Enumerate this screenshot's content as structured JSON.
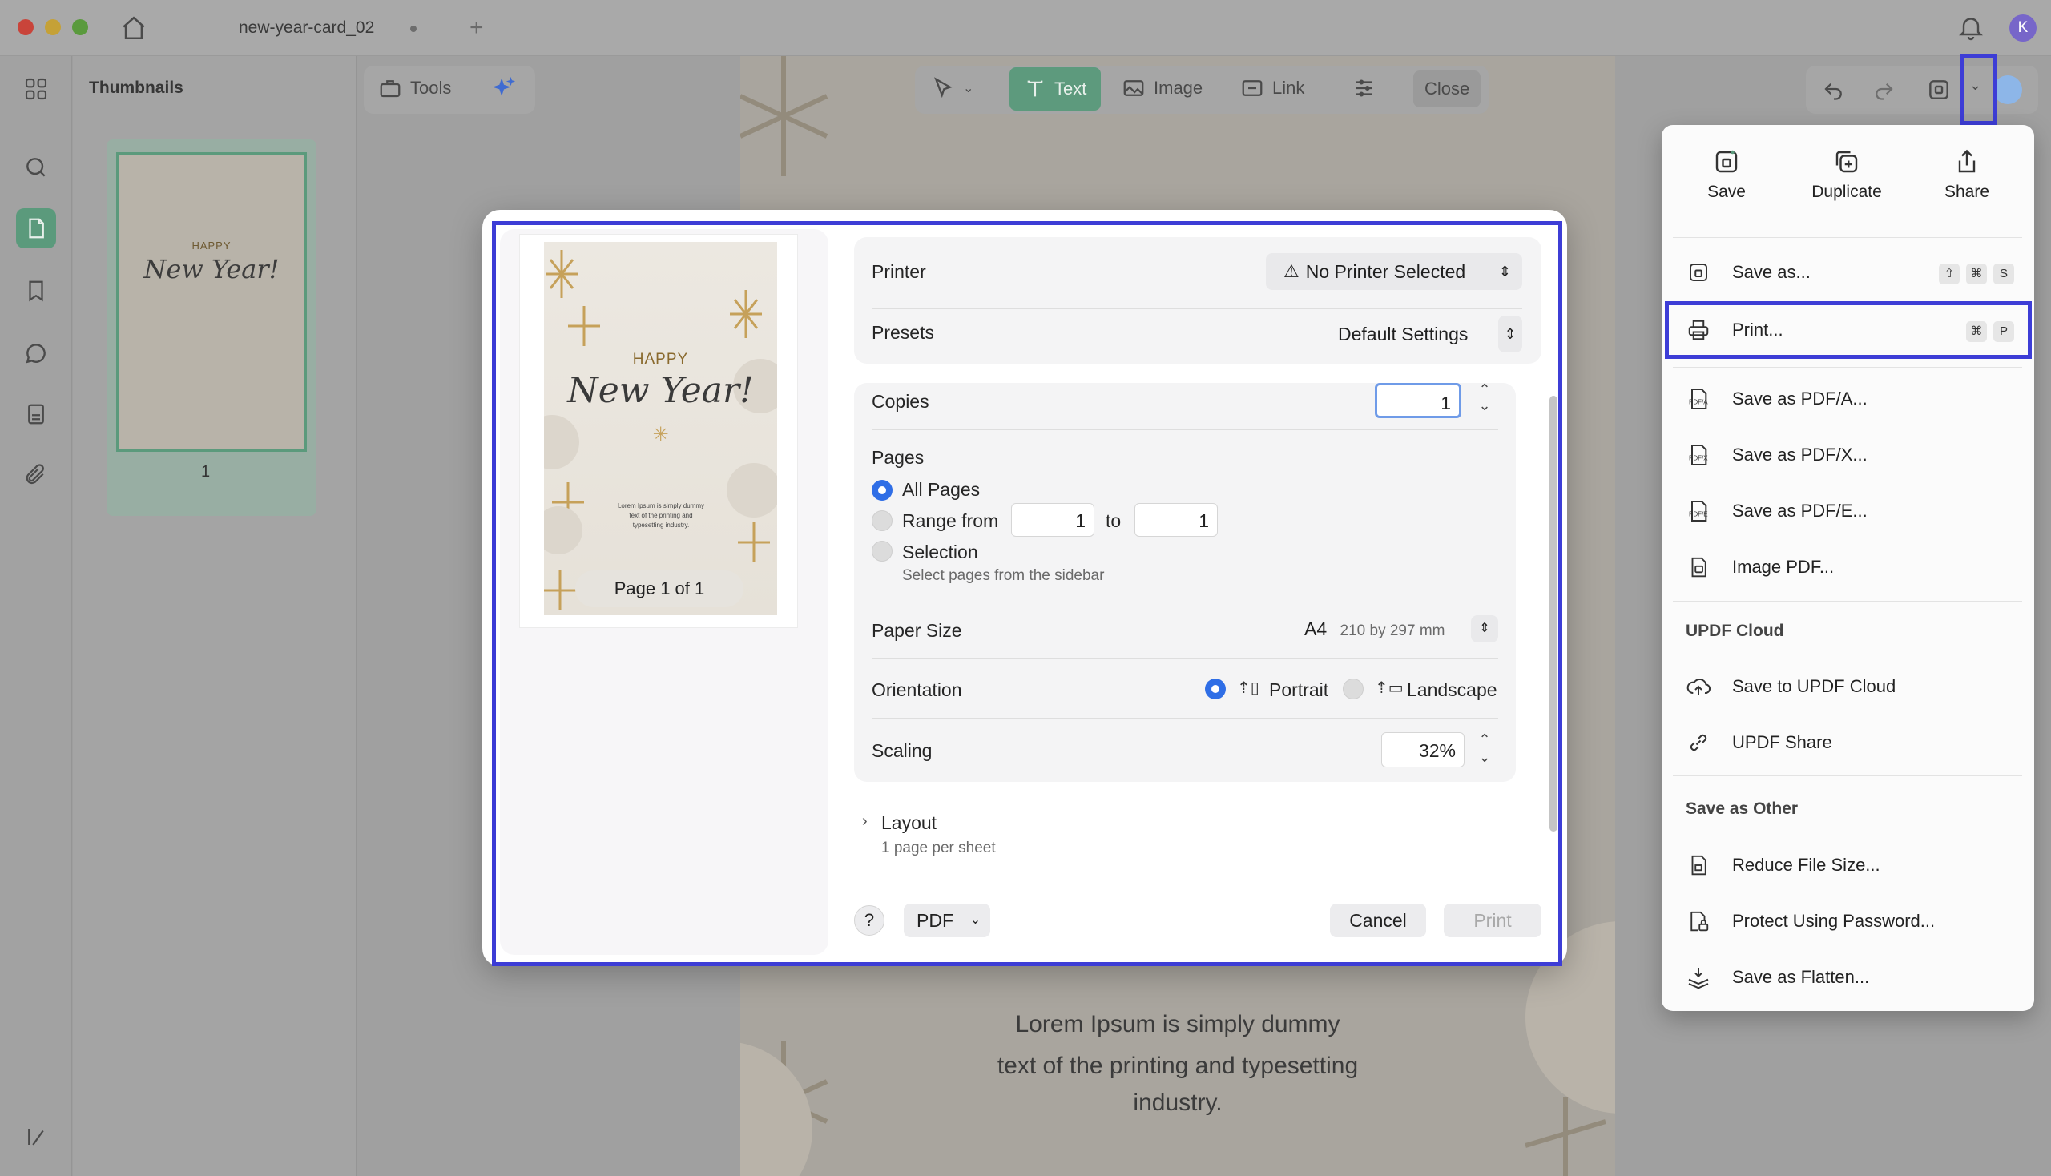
{
  "window": {
    "tab_title": "new-year-card_02"
  },
  "sidebar": {
    "title": "Thumbnails",
    "page_number": "1"
  },
  "toolbar": {
    "tools_label": "Tools",
    "text_label": "Text",
    "image_label": "Image",
    "link_label": "Link",
    "close_label": "Close"
  },
  "document": {
    "line1": "Lorem Ipsum is simply dummy",
    "line2": "text of the printing and typesetting",
    "line3": "industry."
  },
  "print_dialog": {
    "preview": {
      "card_happy": "HAPPY",
      "card_title": "New Year!",
      "card_body": "Lorem Ipsum is simply dummy text of the printing and typesetting industry.",
      "page_label": "Page 1 of 1"
    },
    "printer_label": "Printer",
    "printer_value": "No Printer Selected",
    "presets_label": "Presets",
    "presets_value": "Default Settings",
    "copies_label": "Copies",
    "copies_value": "1",
    "pages_label": "Pages",
    "all_pages_label": "All Pages",
    "range_from_label": "Range from",
    "range_from_value": "1",
    "range_to_label": "to",
    "range_to_value": "1",
    "selection_label": "Selection",
    "selection_hint": "Select pages from the sidebar",
    "pages_selected": "All Pages",
    "paper_size_label": "Paper Size",
    "paper_size_value": "A4",
    "paper_size_dims": "210 by 297 mm",
    "orientation_label": "Orientation",
    "portrait_label": "Portrait",
    "landscape_label": "Landscape",
    "orientation_selected": "Portrait",
    "scaling_label": "Scaling",
    "scaling_value": "32%",
    "layout_label": "Layout",
    "layout_sub": "1 page per sheet",
    "help_label": "?",
    "pdf_label": "PDF",
    "cancel_label": "Cancel",
    "print_label": "Print"
  },
  "save_menu": {
    "top": {
      "save": "Save",
      "duplicate": "Duplicate",
      "share": "Share"
    },
    "items": [
      {
        "label": "Save as...",
        "keys": [
          "⇧",
          "⌘",
          "S"
        ],
        "icon": "save-as-icon"
      },
      {
        "label": "Print...",
        "keys": [
          "⌘",
          "P"
        ],
        "icon": "printer-icon"
      },
      {
        "label": "Save as PDF/A...",
        "icon": "pdf-a-icon"
      },
      {
        "label": "Save as PDF/X...",
        "icon": "pdf-x-icon"
      },
      {
        "label": "Save as PDF/E...",
        "icon": "pdf-e-icon"
      },
      {
        "label": "Image PDF...",
        "icon": "image-pdf-icon"
      }
    ],
    "cloud_header": "UPDF Cloud",
    "cloud_items": [
      {
        "label": "Save to UPDF Cloud",
        "icon": "cloud-upload-icon"
      },
      {
        "label": "UPDF Share",
        "icon": "link-icon"
      }
    ],
    "other_header": "Save as Other",
    "other_items": [
      {
        "label": "Reduce File Size...",
        "icon": "reduce-size-icon"
      },
      {
        "label": "Protect Using Password...",
        "icon": "lock-icon"
      },
      {
        "label": "Save as Flatten...",
        "icon": "flatten-icon"
      }
    ]
  },
  "user": {
    "avatar_letter": "K"
  },
  "colors": {
    "accent_green": "#5b9a7c",
    "highlight_blue": "#3d3dd6",
    "radio_blue": "#2f6ee6"
  }
}
